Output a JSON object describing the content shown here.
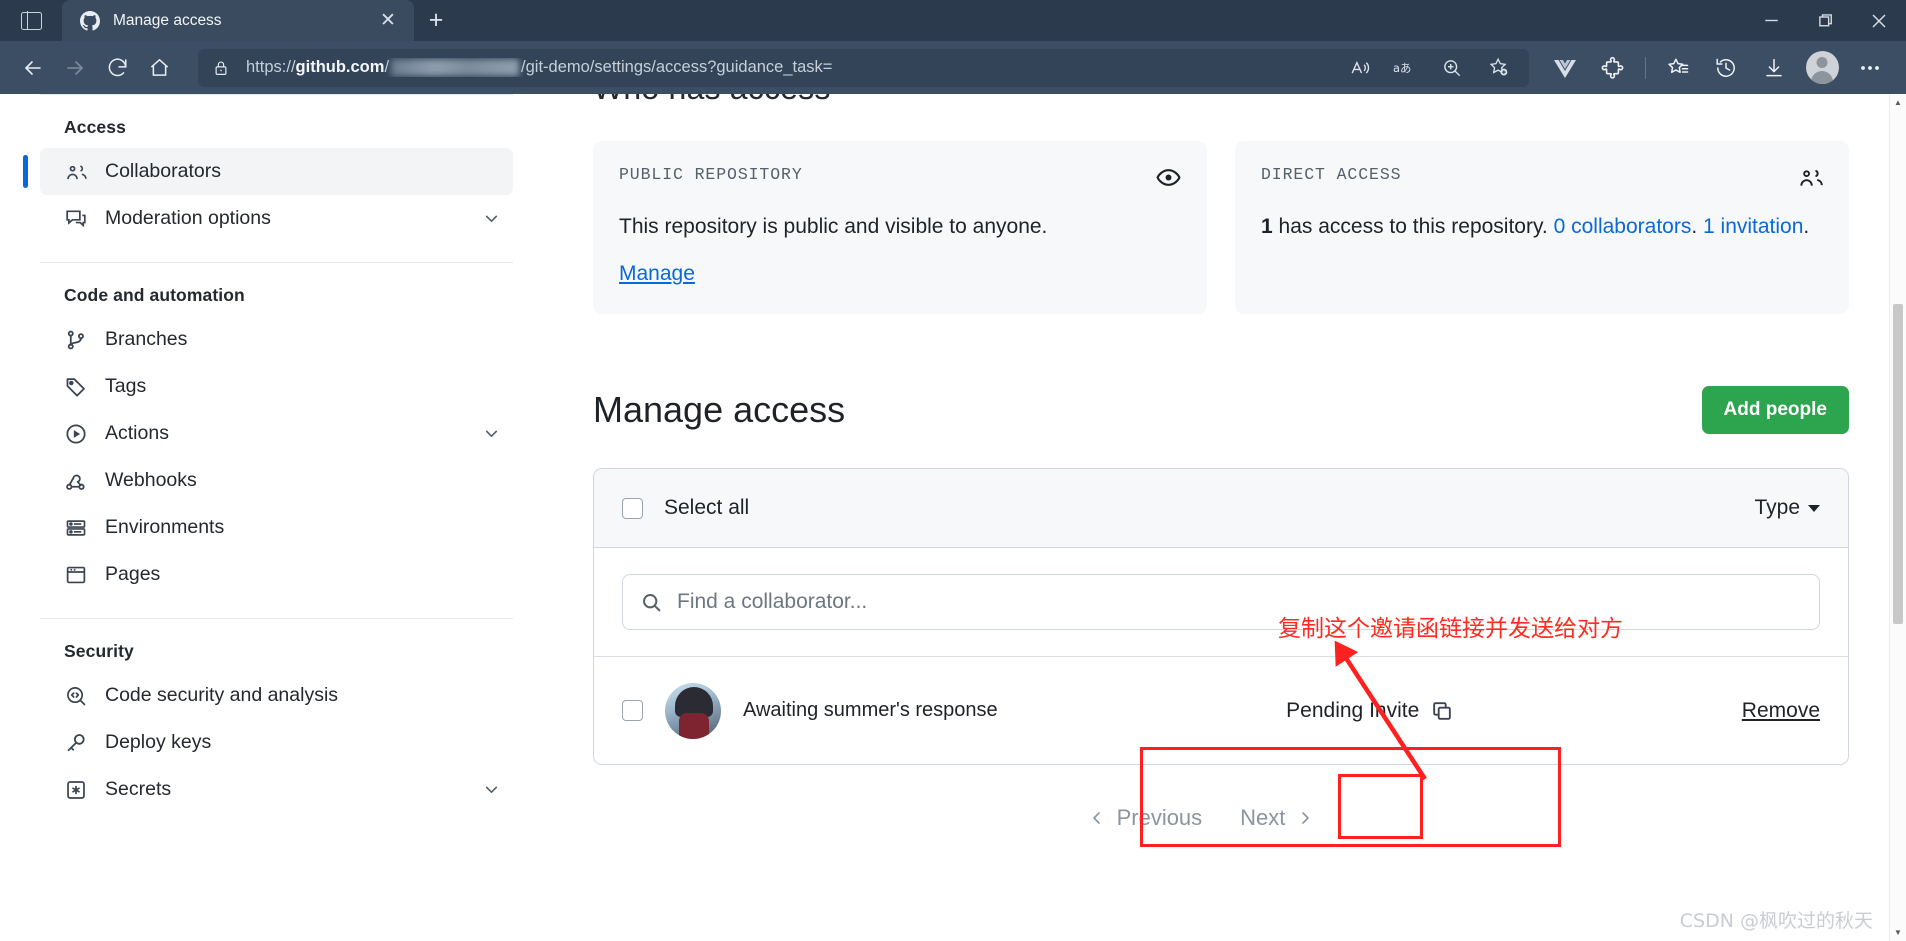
{
  "browser": {
    "tab": {
      "title": "Manage access",
      "favicon": "github-icon",
      "close": "✕"
    },
    "new_tab_label": "+",
    "window_controls": {
      "minimize": "minimize-icon",
      "maximize": "restore-icon",
      "close": "close-icon"
    },
    "nav": {
      "back": "back-arrow-icon",
      "forward": "forward-arrow-icon",
      "refresh": "refresh-icon",
      "home": "home-icon"
    },
    "address": {
      "lock": "lock-icon",
      "scheme": "https://",
      "host": "github.com",
      "path": "/git-demo/settings/access?guidance_task=",
      "redacted": true,
      "actions": [
        "read-aloud-icon",
        "translate-icon",
        "zoom-icon",
        "add-favorite-icon"
      ]
    },
    "toolbar_icons": [
      "vue-devtools-icon",
      "extensions-icon",
      "favorites-icon",
      "history-icon",
      "downloads-icon",
      "profile-avatar",
      "settings-more-icon"
    ]
  },
  "sidebar": {
    "sections": [
      {
        "title": "Access",
        "items": [
          {
            "label": "Collaborators",
            "icon": "people-icon",
            "active": true,
            "expandable": false
          },
          {
            "label": "Moderation options",
            "icon": "comment-discussion-icon",
            "active": false,
            "expandable": true
          }
        ]
      },
      {
        "title": "Code and automation",
        "items": [
          {
            "label": "Branches",
            "icon": "git-branch-icon",
            "active": false,
            "expandable": false
          },
          {
            "label": "Tags",
            "icon": "tag-icon",
            "active": false,
            "expandable": false
          },
          {
            "label": "Actions",
            "icon": "play-icon",
            "active": false,
            "expandable": true
          },
          {
            "label": "Webhooks",
            "icon": "webhook-icon",
            "active": false,
            "expandable": false
          },
          {
            "label": "Environments",
            "icon": "server-icon",
            "active": false,
            "expandable": false
          },
          {
            "label": "Pages",
            "icon": "browser-window-icon",
            "active": false,
            "expandable": false
          }
        ]
      },
      {
        "title": "Security",
        "items": [
          {
            "label": "Code security and analysis",
            "icon": "codescan-icon",
            "active": false,
            "expandable": false
          },
          {
            "label": "Deploy keys",
            "icon": "key-icon",
            "active": false,
            "expandable": false
          },
          {
            "label": "Secrets",
            "icon": "asterisk-icon",
            "active": false,
            "expandable": true
          }
        ]
      }
    ]
  },
  "main": {
    "who_has_access_heading": "Who has access",
    "cards": [
      {
        "title": "PUBLIC REPOSITORY",
        "icon": "eye-icon",
        "body_text": "This repository is public and visible to anyone.",
        "link": "Manage"
      },
      {
        "title": "DIRECT ACCESS",
        "icon": "people-icon",
        "count": "1",
        "body_text": " has access to this repository. ",
        "link_collaborators": "0 collaborators",
        "mid_text": ". ",
        "link_invitation": "1 invitation",
        "end_text": "."
      }
    ],
    "manage_access": {
      "title": "Manage access",
      "add_people_label": "Add people",
      "select_all_label": "Select all",
      "type_filter_label": "Type",
      "search_placeholder": "Find a collaborator...",
      "search_value": "",
      "rows": [
        {
          "username_redacted": true,
          "subtitle": "Awaiting summer's response",
          "status": "Pending Invite",
          "copy_icon": "copy-icon",
          "remove_label": "Remove"
        }
      ],
      "pagination": {
        "previous": "Previous",
        "next": "Next"
      }
    }
  },
  "annotations": {
    "note": "复制这个邀请函链接并发送给对方",
    "color": "#ff2020"
  },
  "watermark": "CSDN @枫吹过的秋天",
  "colors": {
    "accent_green": "#2da44e",
    "link_blue": "#0969da",
    "annotation_red": "#ff2020",
    "chrome_bg": "#3c4e64",
    "titlebar_bg": "#2b3a4d"
  }
}
